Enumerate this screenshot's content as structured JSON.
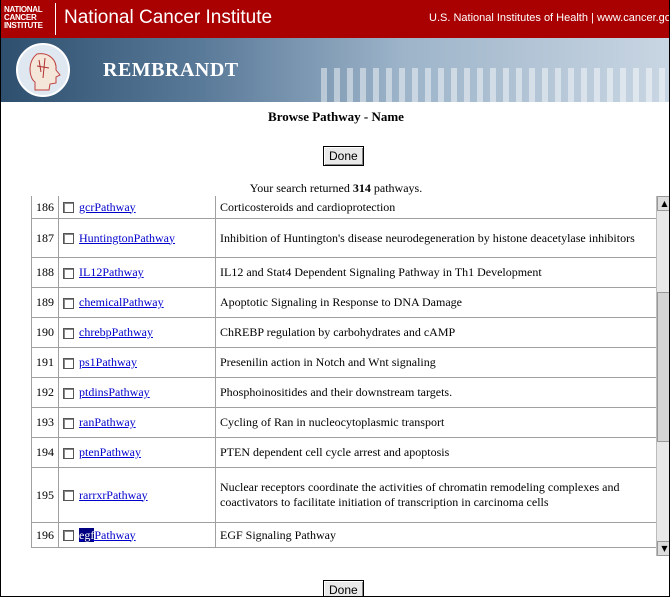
{
  "nci": {
    "logo_lines": [
      "NATIONAL",
      "CANCER",
      "INSTITUTE"
    ],
    "title": "National Cancer Institute",
    "right_text": "U.S. National Institutes of Health | www.cancer.gov"
  },
  "app": {
    "title": "REMBRANDT"
  },
  "page": {
    "title": "Browse Pathway - Name",
    "done_label": "Done",
    "result_prefix": "Your search returned ",
    "result_count": "314",
    "result_suffix": " pathways."
  },
  "rows": [
    {
      "num": "186",
      "name": "gcrPathway",
      "desc": "Corticosteroids and cardioprotection"
    },
    {
      "num": "187",
      "name": "HuntingtonPathway",
      "desc": "Inhibition of Huntington's disease neurodegeneration by histone deacetylase inhibitors"
    },
    {
      "num": "188",
      "name": "IL12Pathway",
      "desc": "IL12 and Stat4 Dependent Signaling Pathway in Th1 Development"
    },
    {
      "num": "189",
      "name": "chemicalPathway",
      "desc": "Apoptotic Signaling in Response to DNA Damage"
    },
    {
      "num": "190",
      "name": "chrebpPathway",
      "desc": "ChREBP regulation by carbohydrates and cAMP"
    },
    {
      "num": "191",
      "name": "ps1Pathway",
      "desc": "Presenilin action in Notch and Wnt signaling"
    },
    {
      "num": "192",
      "name": "ptdinsPathway",
      "desc": "Phosphoinositides and their downstream targets."
    },
    {
      "num": "193",
      "name": "ranPathway",
      "desc": "Cycling of Ran in nucleocytoplasmic transport"
    },
    {
      "num": "194",
      "name": "ptenPathway",
      "desc": "PTEN dependent cell cycle arrest and apoptosis"
    },
    {
      "num": "195",
      "name": "rarrxrPathway",
      "desc": "Nuclear receptors coordinate the activities of chromatin remodeling complexes and coactivators to facilitate initiation of transcription in carcinoma cells"
    },
    {
      "num": "196",
      "name": "egfPathway",
      "name_selected": "egf",
      "name_rest": "Pathway",
      "desc": "EGF Signaling Pathway"
    }
  ],
  "scrollbar": {
    "position_fraction": 0.45
  },
  "icons": {
    "scroll_up": "triangle-up-icon",
    "scroll_down": "triangle-down-icon",
    "logo": "head-profile-icon"
  }
}
